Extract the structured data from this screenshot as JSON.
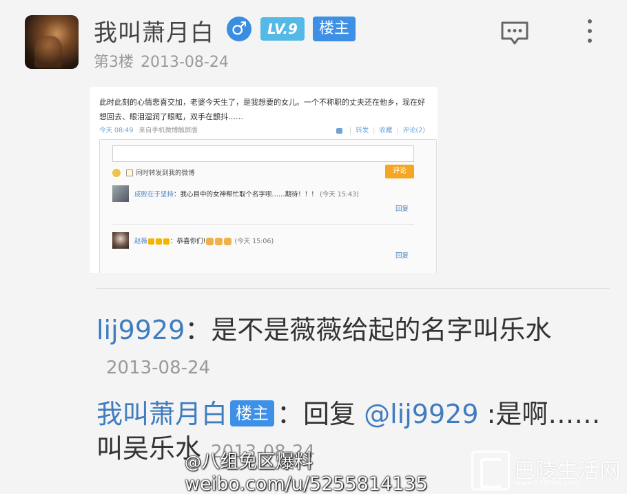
{
  "post": {
    "username": "我叫萧月白",
    "gender_symbol": "♂",
    "level_badge": "LV.9",
    "owner_badge": "楼主",
    "floor": "第3楼",
    "date": "2013-08-24"
  },
  "embedded_weibo": {
    "text": "此时此刻的心情悲喜交加，老婆今天生了，是我想要的女儿。一个不称职的丈夫还在他乡，现在好想回去、眼泪湿润了眼眶，双手在颤抖……",
    "time": "今天 08:49",
    "source": "来自手机微博触屏版",
    "actions": {
      "forward": "转发",
      "favorite": "收藏",
      "comment": "评论(2)"
    },
    "comment_box": {
      "forward_label": "同时转发到我的微博",
      "submit": "评论"
    },
    "comments": [
      {
        "name": "成败在于坚持",
        "text": "：我心目中的女神帮忙取个名字呗……期待！！！",
        "time": "(今天 15:43)",
        "reply": "回复"
      },
      {
        "name": "赵薇",
        "text": "：恭喜你们!",
        "time": "(今天 15:06)",
        "reply": "回复"
      }
    ]
  },
  "replies": [
    {
      "user": "lij9929",
      "sep": "：",
      "text": "是不是薇薇给起的名字叫乐水",
      "date": "2013-08-24"
    },
    {
      "user": "我叫萧月白",
      "badge": "楼主",
      "sep": "：",
      "prefix": "回复 ",
      "mention": "@lij9929",
      "text": " :是啊……叫吴乐水",
      "date": "2013-08-24"
    }
  ],
  "watermark": {
    "line1": "八组免区爆料",
    "line2": "weibo.com/u/5255814135",
    "brand": "巴陵生活网",
    "brand_url": "www.0730life.com"
  },
  "colors": {
    "link": "#3f7cc0",
    "owner_badge": "#3e8fe6",
    "level_badge": "#55b9e8",
    "gender": "#3a8de0"
  },
  "icons": [
    "comment-icon",
    "more-vertical-icon",
    "male-icon"
  ]
}
